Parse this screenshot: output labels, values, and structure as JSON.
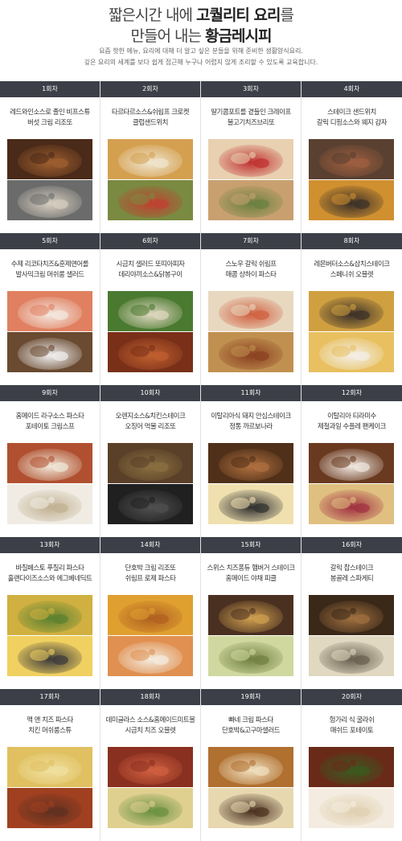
{
  "header": {
    "line1_pre": "짧은시간 내에 ",
    "line1_bold": "고퀄리티 요리",
    "line1_post": "를",
    "line2_pre": "만들어 내는 ",
    "line2_bold": "황금레시피",
    "desc1": "요즘 핫한 메뉴, 요리에 대해 더 알고 싶은 분들을 위해 준비한 생활양식요리.",
    "desc2": "깊은 요리의 세계를 보다 쉽게 접근해 누구나 어렵지 않게 조리할 수 있도록 교육합니다."
  },
  "sessions": [
    {
      "label": "1회차",
      "line1": "레드와인소스로 졸인 비프스튜",
      "line2": "버섯 크림 리조또",
      "c1": "#4a2a18",
      "c2": "#a06030",
      "c3": "#6b6b6b",
      "c4": "#d8cfc0"
    },
    {
      "label": "2회차",
      "line1": "타르타르소스&쉬림프 크로켓",
      "line2": "클럽샌드위치",
      "c1": "#d4a050",
      "c2": "#f0e6d0",
      "c3": "#7a8a40",
      "c4": "#c04030"
    },
    {
      "label": "3회차",
      "line1": "딸기콤포트를 곁들인 크레이프",
      "line2": "불고기치즈브리또",
      "c1": "#e8d0b0",
      "c2": "#c03030",
      "c3": "#c8a070",
      "c4": "#6a8040"
    },
    {
      "label": "4회차",
      "line1": "스테이크 샌드위치",
      "line2": "갈릭 디핑소스와 웨지 감자",
      "c1": "#5a4030",
      "c2": "#a06040",
      "c3": "#d09030",
      "c4": "#3a3028"
    },
    {
      "label": "5회차",
      "line1": "수제 리코타치즈&훈제연어롤",
      "line2": "발사믹크림 머쉬룸 샐러드",
      "c1": "#e08060",
      "c2": "#f4e8e0",
      "c3": "#6a4a30",
      "c4": "#f0f0f0"
    },
    {
      "label": "6회차",
      "line1": "시금치 샐러드 또띠아피자",
      "line2": "데리야끼소스&닭봉구이",
      "c1": "#4a7a30",
      "c2": "#e0d8c0",
      "c3": "#7a3018",
      "c4": "#c06030"
    },
    {
      "label": "7회차",
      "line1": "스노우 갈릭 쉬림프",
      "line2": "매콤 상하이 파스타",
      "c1": "#e8d8c0",
      "c2": "#d06040",
      "c3": "#c09050",
      "c4": "#8a4020"
    },
    {
      "label": "8회차",
      "line1": "레몬버터소스&삼치스테이크",
      "line2": "스페니쉬 오믈렛",
      "c1": "#d0a040",
      "c2": "#3a3028",
      "c3": "#e8c060",
      "c4": "#f4f0e8"
    },
    {
      "label": "9회차",
      "line1": "홈메이드 라구소스 파스타",
      "line2": "포테이토 크림스프",
      "c1": "#b05030",
      "c2": "#f0e8d8",
      "c3": "#f0ece4",
      "c4": "#c0b090"
    },
    {
      "label": "10회차",
      "line1": "오렌지소스&치킨스테이크",
      "line2": "오징어 먹물 리조또",
      "c1": "#5a4028",
      "c2": "#8a7040",
      "c3": "#202020",
      "c4": "#505050"
    },
    {
      "label": "11회차",
      "line1": "이탈리아식 돼지 안심스테이크",
      "line2": "정통 까르보나라",
      "c1": "#503018",
      "c2": "#b07040",
      "c3": "#f0e0b0",
      "c4": "#303030"
    },
    {
      "label": "12회차",
      "line1": "이탈리아 티라미수",
      "line2": "제철과일 수플레 팬케이크",
      "c1": "#6a3a20",
      "c2": "#f0e8e0",
      "c3": "#e0c080",
      "c4": "#a03040"
    },
    {
      "label": "13회차",
      "line1": "바질페스토 푸질리 파스타",
      "line2": "홀랜다이즈소스와 에그베네딕트",
      "c1": "#d0b040",
      "c2": "#5a8030",
      "c3": "#f0d060",
      "c4": "#3a3a3a"
    },
    {
      "label": "14회차",
      "line1": "단호박 크림 리조또",
      "line2": "쉬림프 로제 파스타",
      "c1": "#e0a030",
      "c2": "#b06020",
      "c3": "#e09050",
      "c4": "#f4ece0"
    },
    {
      "label": "15회차",
      "line1": "스위스 치즈퐁듀 햄버거 스테이크",
      "line2": "홈메이드 야채 피클",
      "c1": "#4a3020",
      "c2": "#d0a050",
      "c3": "#d0d8a0",
      "c4": "#708040"
    },
    {
      "label": "16회차",
      "line1": "갈릭 찹스테이크",
      "line2": "봉골레 스파게티",
      "c1": "#3a2818",
      "c2": "#a07040",
      "c3": "#e0d8c0",
      "c4": "#6a6050"
    },
    {
      "label": "17회차",
      "line1": "맥 앤 치즈 파스타",
      "line2": "치킨 머쉬룸스튜",
      "c1": "#e0c060",
      "c2": "#f0e0a0",
      "c3": "#a04020",
      "c4": "#603020"
    },
    {
      "label": "18회차",
      "line1": "데미글라스 소스&홈메이드미트볼",
      "line2": "시금치 치즈 오믈렛",
      "c1": "#8a3020",
      "c2": "#d06040",
      "c3": "#e0d090",
      "c4": "#6a9040"
    },
    {
      "label": "19회차",
      "line1": "빠네 크림 파스타",
      "line2": "단호박&고구마샐러드",
      "c1": "#b07030",
      "c2": "#f0e0c0",
      "c3": "#e8d8b0",
      "c4": "#4a3020"
    },
    {
      "label": "20회차",
      "line1": "헝가리 식 굴라쉬",
      "line2": "매쉬드 포테이토",
      "c1": "#6a2a18",
      "c2": "#3a5a20",
      "c3": "#f4ece0",
      "c4": "#e0d0b0"
    }
  ]
}
